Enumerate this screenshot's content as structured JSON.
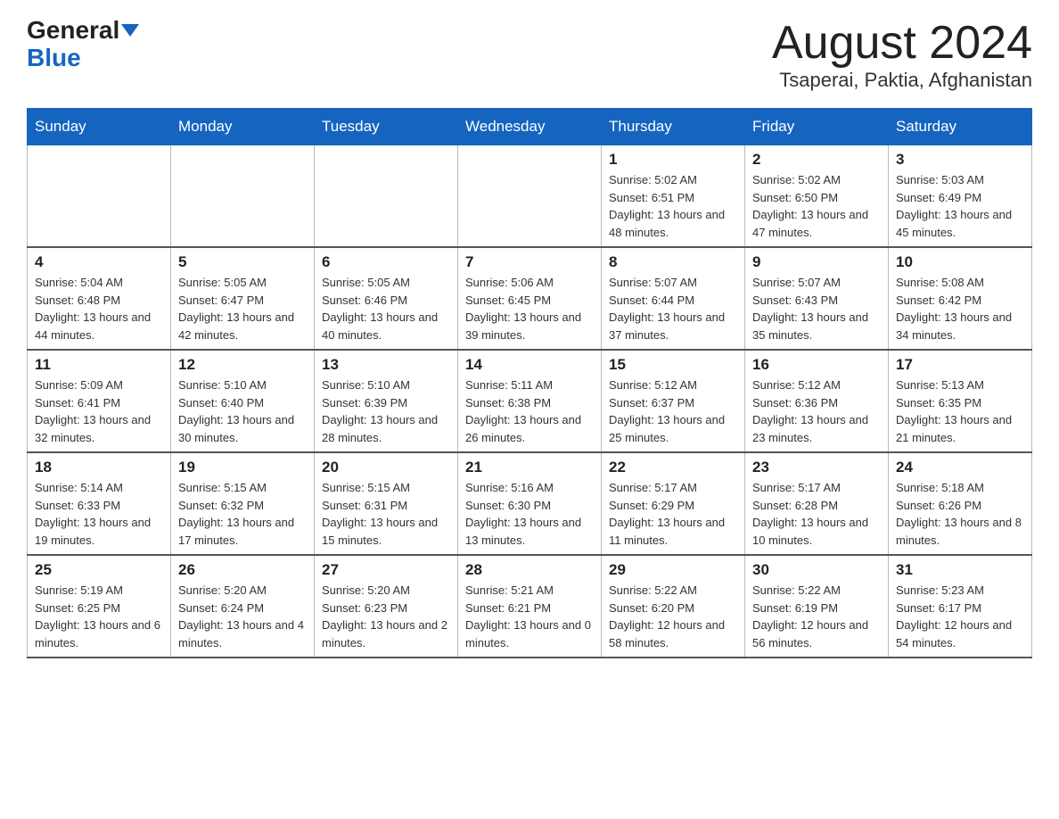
{
  "header": {
    "logo_part1": "General",
    "logo_part2": "Blue",
    "title": "August 2024",
    "subtitle": "Tsaperai, Paktia, Afghanistan"
  },
  "days_of_week": [
    "Sunday",
    "Monday",
    "Tuesday",
    "Wednesday",
    "Thursday",
    "Friday",
    "Saturday"
  ],
  "weeks": [
    [
      {
        "day": "",
        "info": ""
      },
      {
        "day": "",
        "info": ""
      },
      {
        "day": "",
        "info": ""
      },
      {
        "day": "",
        "info": ""
      },
      {
        "day": "1",
        "info": "Sunrise: 5:02 AM\nSunset: 6:51 PM\nDaylight: 13 hours and 48 minutes."
      },
      {
        "day": "2",
        "info": "Sunrise: 5:02 AM\nSunset: 6:50 PM\nDaylight: 13 hours and 47 minutes."
      },
      {
        "day": "3",
        "info": "Sunrise: 5:03 AM\nSunset: 6:49 PM\nDaylight: 13 hours and 45 minutes."
      }
    ],
    [
      {
        "day": "4",
        "info": "Sunrise: 5:04 AM\nSunset: 6:48 PM\nDaylight: 13 hours and 44 minutes."
      },
      {
        "day": "5",
        "info": "Sunrise: 5:05 AM\nSunset: 6:47 PM\nDaylight: 13 hours and 42 minutes."
      },
      {
        "day": "6",
        "info": "Sunrise: 5:05 AM\nSunset: 6:46 PM\nDaylight: 13 hours and 40 minutes."
      },
      {
        "day": "7",
        "info": "Sunrise: 5:06 AM\nSunset: 6:45 PM\nDaylight: 13 hours and 39 minutes."
      },
      {
        "day": "8",
        "info": "Sunrise: 5:07 AM\nSunset: 6:44 PM\nDaylight: 13 hours and 37 minutes."
      },
      {
        "day": "9",
        "info": "Sunrise: 5:07 AM\nSunset: 6:43 PM\nDaylight: 13 hours and 35 minutes."
      },
      {
        "day": "10",
        "info": "Sunrise: 5:08 AM\nSunset: 6:42 PM\nDaylight: 13 hours and 34 minutes."
      }
    ],
    [
      {
        "day": "11",
        "info": "Sunrise: 5:09 AM\nSunset: 6:41 PM\nDaylight: 13 hours and 32 minutes."
      },
      {
        "day": "12",
        "info": "Sunrise: 5:10 AM\nSunset: 6:40 PM\nDaylight: 13 hours and 30 minutes."
      },
      {
        "day": "13",
        "info": "Sunrise: 5:10 AM\nSunset: 6:39 PM\nDaylight: 13 hours and 28 minutes."
      },
      {
        "day": "14",
        "info": "Sunrise: 5:11 AM\nSunset: 6:38 PM\nDaylight: 13 hours and 26 minutes."
      },
      {
        "day": "15",
        "info": "Sunrise: 5:12 AM\nSunset: 6:37 PM\nDaylight: 13 hours and 25 minutes."
      },
      {
        "day": "16",
        "info": "Sunrise: 5:12 AM\nSunset: 6:36 PM\nDaylight: 13 hours and 23 minutes."
      },
      {
        "day": "17",
        "info": "Sunrise: 5:13 AM\nSunset: 6:35 PM\nDaylight: 13 hours and 21 minutes."
      }
    ],
    [
      {
        "day": "18",
        "info": "Sunrise: 5:14 AM\nSunset: 6:33 PM\nDaylight: 13 hours and 19 minutes."
      },
      {
        "day": "19",
        "info": "Sunrise: 5:15 AM\nSunset: 6:32 PM\nDaylight: 13 hours and 17 minutes."
      },
      {
        "day": "20",
        "info": "Sunrise: 5:15 AM\nSunset: 6:31 PM\nDaylight: 13 hours and 15 minutes."
      },
      {
        "day": "21",
        "info": "Sunrise: 5:16 AM\nSunset: 6:30 PM\nDaylight: 13 hours and 13 minutes."
      },
      {
        "day": "22",
        "info": "Sunrise: 5:17 AM\nSunset: 6:29 PM\nDaylight: 13 hours and 11 minutes."
      },
      {
        "day": "23",
        "info": "Sunrise: 5:17 AM\nSunset: 6:28 PM\nDaylight: 13 hours and 10 minutes."
      },
      {
        "day": "24",
        "info": "Sunrise: 5:18 AM\nSunset: 6:26 PM\nDaylight: 13 hours and 8 minutes."
      }
    ],
    [
      {
        "day": "25",
        "info": "Sunrise: 5:19 AM\nSunset: 6:25 PM\nDaylight: 13 hours and 6 minutes."
      },
      {
        "day": "26",
        "info": "Sunrise: 5:20 AM\nSunset: 6:24 PM\nDaylight: 13 hours and 4 minutes."
      },
      {
        "day": "27",
        "info": "Sunrise: 5:20 AM\nSunset: 6:23 PM\nDaylight: 13 hours and 2 minutes."
      },
      {
        "day": "28",
        "info": "Sunrise: 5:21 AM\nSunset: 6:21 PM\nDaylight: 13 hours and 0 minutes."
      },
      {
        "day": "29",
        "info": "Sunrise: 5:22 AM\nSunset: 6:20 PM\nDaylight: 12 hours and 58 minutes."
      },
      {
        "day": "30",
        "info": "Sunrise: 5:22 AM\nSunset: 6:19 PM\nDaylight: 12 hours and 56 minutes."
      },
      {
        "day": "31",
        "info": "Sunrise: 5:23 AM\nSunset: 6:17 PM\nDaylight: 12 hours and 54 minutes."
      }
    ]
  ]
}
